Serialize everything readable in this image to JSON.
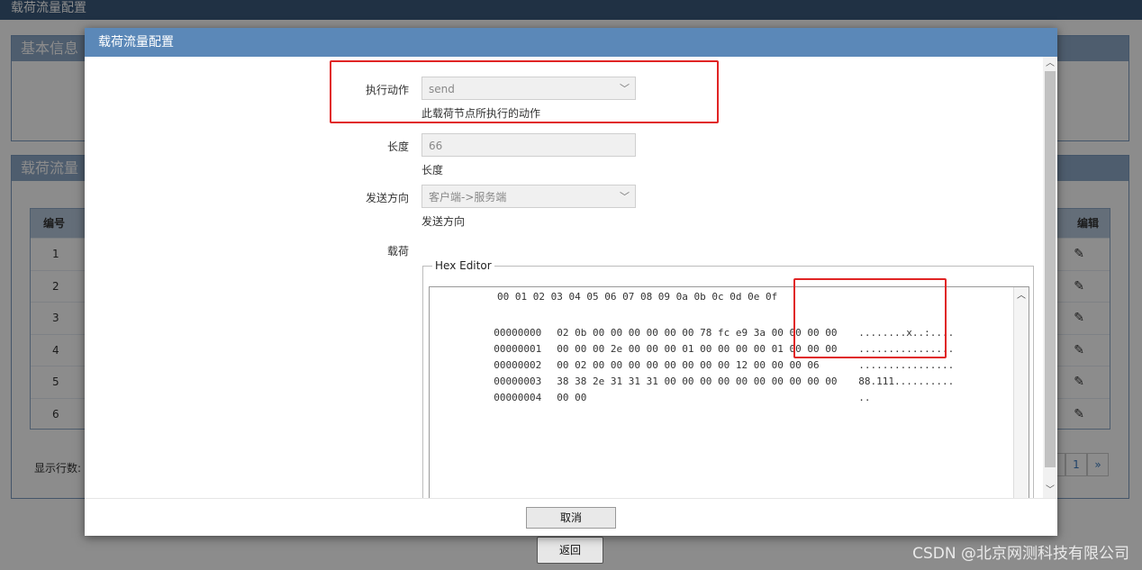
{
  "background": {
    "window_title": "载荷流量配置",
    "basic_info_title": "基本信息",
    "payload_flow_title": "载荷流量",
    "table_headers": {
      "id": "编号",
      "edit": "编辑"
    },
    "rows": [
      {
        "id": "1"
      },
      {
        "id": "2"
      },
      {
        "id": "3"
      },
      {
        "id": "4"
      },
      {
        "id": "5"
      },
      {
        "id": "6"
      }
    ],
    "rows_per_page_label": "显示行数:",
    "pager": {
      "prev": "‹",
      "current": "1",
      "next": "»"
    },
    "back_button": "返回",
    "watermark": "CSDN @北京网测科技有限公司"
  },
  "modal": {
    "title": "载荷流量配置",
    "action": {
      "label": "执行动作",
      "value": "send",
      "hint": "此载荷节点所执行的动作"
    },
    "length": {
      "label": "长度",
      "value": "66",
      "hint": "长度"
    },
    "direction": {
      "label": "发送方向",
      "value": "客户端->服务端",
      "hint": "发送方向"
    },
    "payload": {
      "label": "载荷",
      "legend": "Hex Editor",
      "header": "00 01 02 03 04 05 06 07 08 09 0a 0b 0c 0d 0e 0f",
      "rows": [
        {
          "offset": "00000000",
          "bytes": "02 0b 00 00 00 00 00 00 78 fc e9 3a 00 00 00 00",
          "ascii": "........x..:...."
        },
        {
          "offset": "00000001",
          "bytes": "00 00 00 2e 00 00 00 01 00 00 00 00 01 00 00 00",
          "ascii": "................"
        },
        {
          "offset": "00000002",
          "bytes": "00 02 00 00 00 00 00 00 00 00 12 00 00 00 06",
          "ascii": "................"
        },
        {
          "offset": "00000003",
          "bytes": "38 38 2e 31 31 31 00 00 00 00 00 00 00 00 00 00",
          "ascii": "88.111.........."
        },
        {
          "offset": "00000004",
          "bytes": "00 00",
          "ascii": ".."
        }
      ]
    },
    "cancel_button": "取消"
  }
}
